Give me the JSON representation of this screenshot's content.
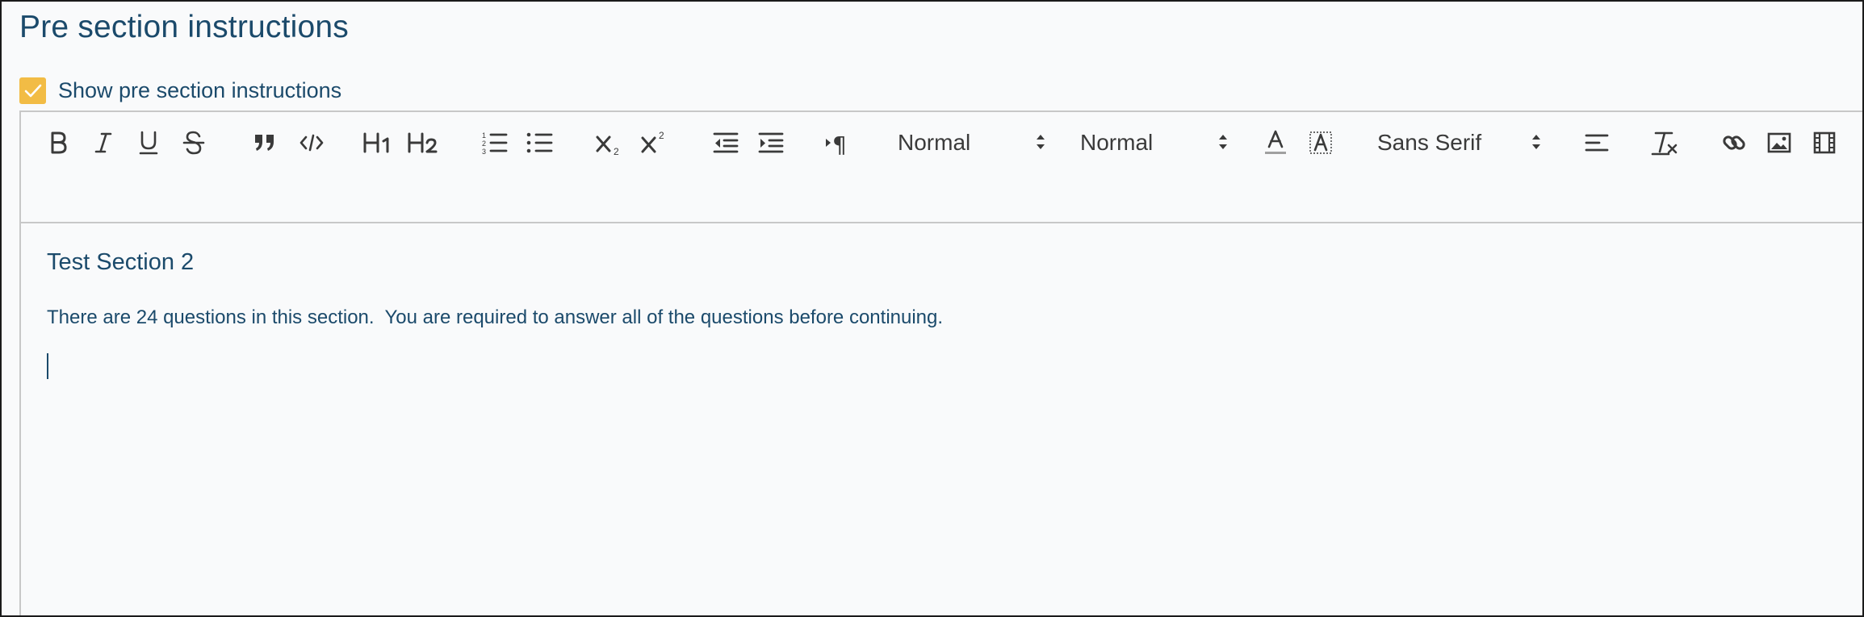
{
  "section": {
    "title": "Pre section instructions",
    "checkbox_label": "Show pre section instructions",
    "checkbox_checked": true
  },
  "toolbar": {
    "header_select": "Normal",
    "size_select": "Normal",
    "font_select": "Sans Serif",
    "buttons": [
      "bold",
      "italic",
      "underline",
      "strike",
      "blockquote",
      "code-block",
      "h1",
      "h2",
      "ordered-list",
      "bullet-list",
      "subscript",
      "superscript",
      "outdent",
      "indent",
      "rtl",
      "text-color",
      "background-color",
      "align",
      "clean",
      "link",
      "image",
      "video"
    ]
  },
  "editor": {
    "heading": "Test Section 2",
    "paragraph": "There are 24 questions in this section.  You are required to answer all of the questions before continuing."
  },
  "colors": {
    "accent": "#f2bc45",
    "text": "#1b4a6b",
    "border": "#c8c8c8"
  }
}
